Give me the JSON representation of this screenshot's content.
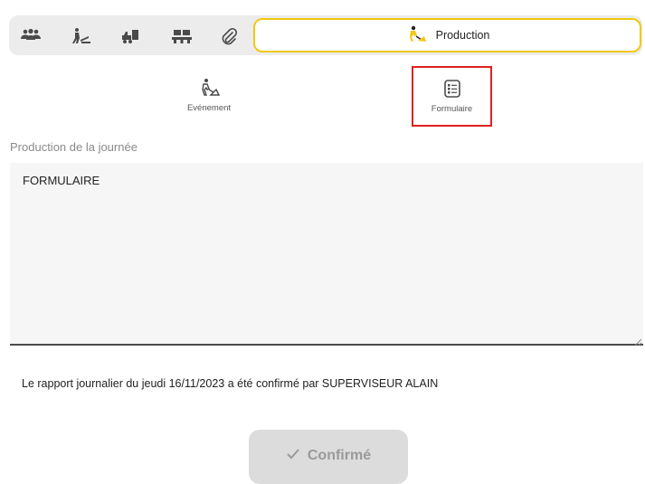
{
  "tabs": {
    "icons": [
      "team-icon",
      "worker-icon",
      "equipment-icon",
      "materials-icon",
      "attachment-icon"
    ],
    "active_label": "Production",
    "accent_color": "#f2c811"
  },
  "subtabs": {
    "event_label": "Evénement",
    "form_label": "Formulaire",
    "highlight_color": "#e02020"
  },
  "production": {
    "label": "Production de la journée",
    "value": "FORMULAIRE"
  },
  "status": {
    "message": "Le rapport journalier du jeudi 16/11/2023 a été confirmé par SUPERVISEUR ALAIN"
  },
  "confirm": {
    "label": "Confirmé"
  }
}
